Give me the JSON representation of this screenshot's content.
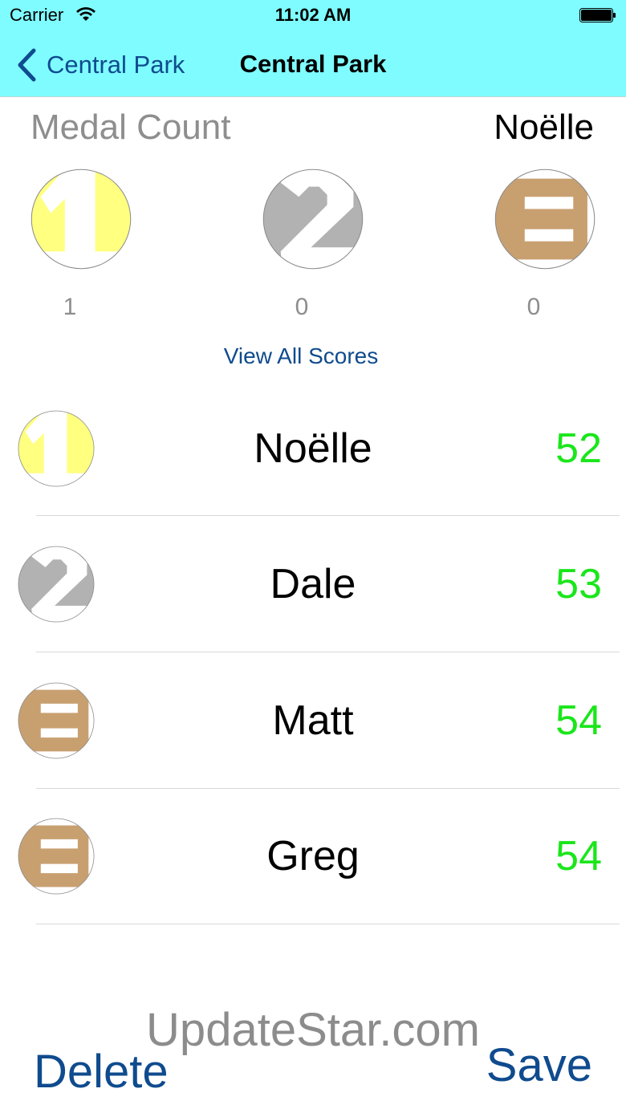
{
  "status_bar": {
    "carrier": "Carrier",
    "time": "11:02 AM"
  },
  "nav": {
    "back_label": "Central Park",
    "title": "Central Park"
  },
  "medal_summary": {
    "heading": "Medal Count",
    "player": "Noëlle",
    "medals": [
      {
        "icon": "gold-medal-1-icon",
        "color": "#ffff80",
        "count": "1"
      },
      {
        "icon": "silver-medal-2-icon",
        "color": "#b2b2b2",
        "count": "0"
      },
      {
        "icon": "bronze-medal-3-icon",
        "color": "#c8a070",
        "count": "0"
      }
    ],
    "view_all_label": "View All Scores"
  },
  "scores": [
    {
      "medal": "gold-medal-1-icon",
      "name": "Noëlle",
      "score": "52"
    },
    {
      "medal": "silver-medal-2-icon",
      "name": "Dale",
      "score": "53"
    },
    {
      "medal": "bronze-medal-3-icon",
      "name": "Matt",
      "score": "54"
    },
    {
      "medal": "bronze-medal-3-icon",
      "name": "Greg",
      "score": "54"
    }
  ],
  "colors": {
    "nav_background": "#7ffcff",
    "link_blue": "#0f4b8e",
    "score_green": "#1ae61a",
    "gold": "#ffff80",
    "silver": "#b2b2b2",
    "bronze": "#c8a070"
  },
  "watermark": "UpdateStar.com",
  "footer": {
    "delete_label": "Delete",
    "save_label": "Save"
  }
}
